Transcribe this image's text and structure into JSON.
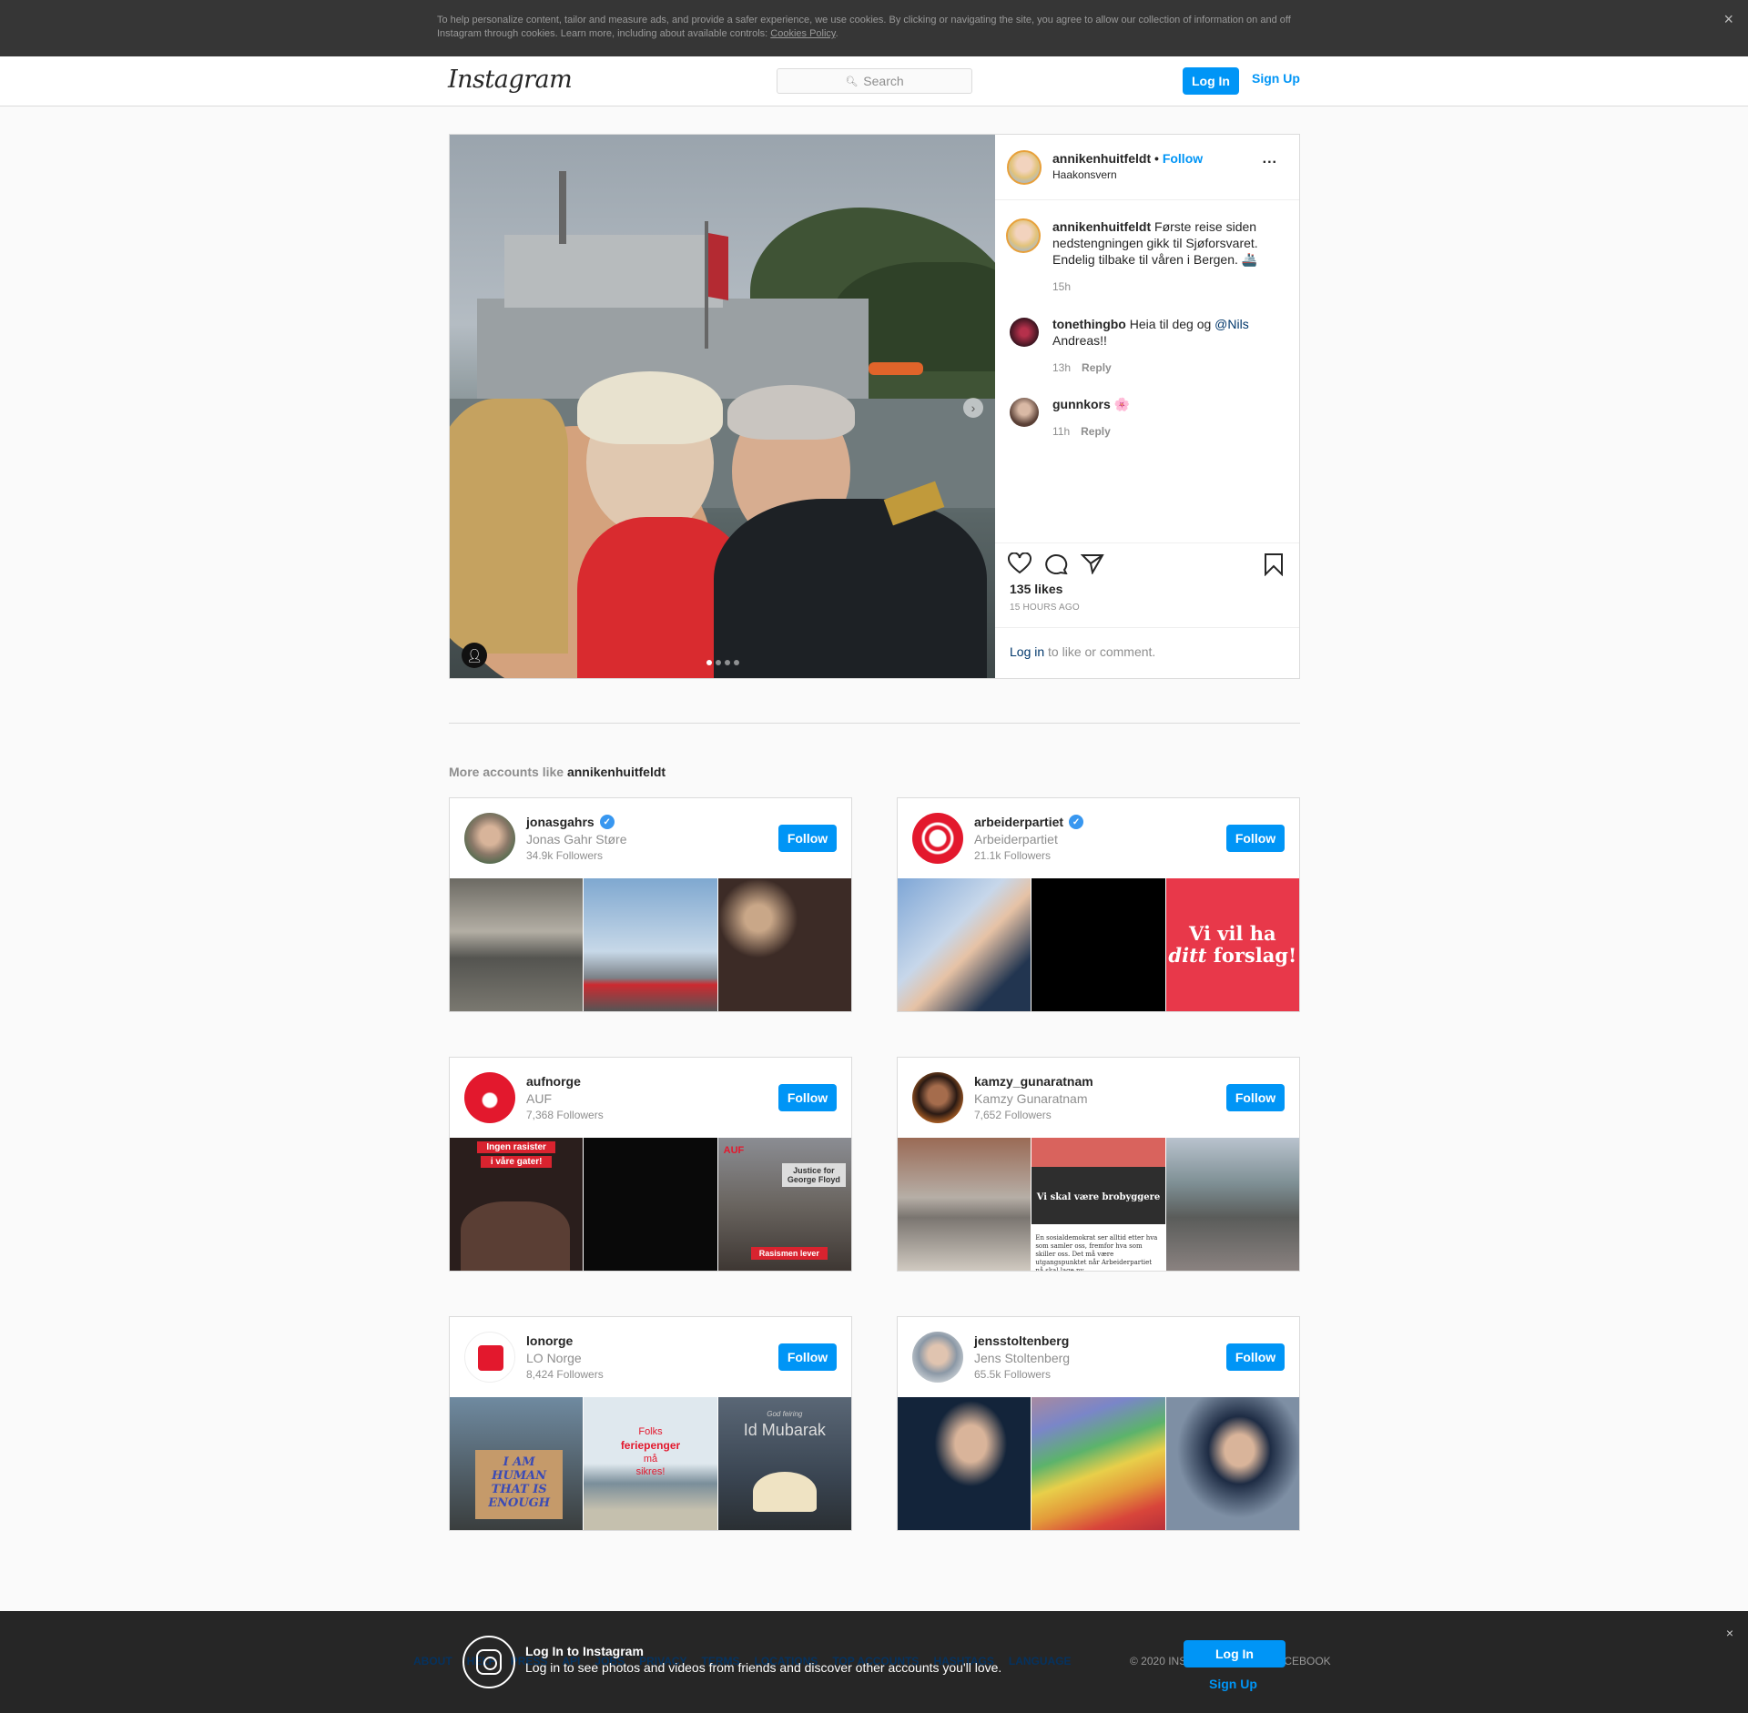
{
  "cookie": {
    "text": "To help personalize content, tailor and measure ads, and provide a safer experience, we use cookies. By clicking or navigating the site, you agree to allow our collection of information on and off Instagram through cookies. Learn more, including about available controls: ",
    "link": "Cookies Policy",
    "end": ".",
    "close": "×"
  },
  "header": {
    "logo": "Instagram",
    "search_placeholder": "Search",
    "login": "Log In",
    "signup": "Sign Up"
  },
  "post": {
    "username": "annikenhuitfeldt",
    "dot": " • ",
    "follow": "Follow",
    "location": "Haakonsvern",
    "more": "...",
    "caption_user": "annikenhuitfeldt",
    "caption": " Første reise siden nedstengningen gikk til Sjøforsvaret. Endelig tilbake til våren i Bergen. 🚢",
    "caption_time": "15h",
    "comments": [
      {
        "user": "tonethingbo",
        "text_before": " Heia til deg og ",
        "mention": "@Nils",
        "text_after": " Andreas!!",
        "time": "13h",
        "reply": "Reply"
      },
      {
        "user": "gunnkors",
        "text_before": " 🌸",
        "mention": "",
        "text_after": "",
        "time": "11h",
        "reply": "Reply"
      }
    ],
    "likes": "135 likes",
    "ago": "15 HOURS AGO",
    "login_link": "Log in",
    "login_rest": " to like or comment."
  },
  "more": {
    "prefix": "More accounts like ",
    "account": "annikenhuitfeldt"
  },
  "cards": [
    {
      "user": "jonasgahrs",
      "verified": true,
      "name": "Jonas Gahr Støre",
      "followers": "34.9k Followers",
      "follow": "Follow"
    },
    {
      "user": "arbeiderpartiet",
      "verified": true,
      "name": "Arbeiderpartiet",
      "followers": "21.1k Followers",
      "follow": "Follow"
    },
    {
      "user": "aufnorge",
      "verified": false,
      "name": "AUF",
      "followers": "7,368 Followers",
      "follow": "Follow"
    },
    {
      "user": "kamzy_gunaratnam",
      "verified": false,
      "name": "Kamzy Gunaratnam",
      "followers": "7,652 Followers",
      "follow": "Follow"
    },
    {
      "user": "lonorge",
      "verified": false,
      "name": "LO Norge",
      "followers": "8,424 Followers",
      "follow": "Follow"
    },
    {
      "user": "jensstoltenberg",
      "verified": false,
      "name": "Jens Stoltenberg",
      "followers": "65.5k Followers",
      "follow": "Follow"
    }
  ],
  "thumb_text": {
    "ap_line1": "Vi vil ha",
    "ap_line2a": "ditt",
    "ap_line2b": " forslag!",
    "auf_a": "Ingen rasister",
    "auf_b": "i våre gater!",
    "auf_c": "Rasismen lever",
    "auf_logo": "AUF",
    "auf_sign": "Justice for George Floyd",
    "kg_title": "Vi skal være brobyggere",
    "kg_body": "En sosialdemokrat ser alltid etter hva som samler oss, fremfor hva som skiller oss. Det må være utgangspunktet når Arbeiderpartiet nå skal lage ny",
    "lo_sign": "I AM HUMAN THAT IS ENOUGH",
    "lo_a": "Folks",
    "lo_b": "feriepenger",
    "lo_c": "må",
    "lo_d": "sikres!",
    "lo_e": "Id Mubarak",
    "lo_f": "God feiring"
  },
  "footer": {
    "links": [
      "ABOUT",
      "HELP",
      "PRESS",
      "API",
      "JOBS",
      "PRIVACY",
      "TERMS",
      "LOCATIONS",
      "TOP ACCOUNTS",
      "HASHTAGS",
      "LANGUAGE"
    ],
    "copyright": "© 2020 INSTAGRAM FROM FACEBOOK",
    "title": "Log In to Instagram",
    "subtitle": "Log in to see photos and videos from friends and discover other accounts you'll love.",
    "login": "Log In",
    "signup": "Sign Up",
    "close": "×"
  },
  "colors": {
    "accent": "#0095f6",
    "verified": "#3897f0",
    "text": "#262626",
    "muted": "#8e8e8e"
  },
  "icons": {
    "heart": "heart-icon",
    "comment": "comment-icon",
    "share": "share-icon",
    "bookmark": "bookmark-icon"
  }
}
